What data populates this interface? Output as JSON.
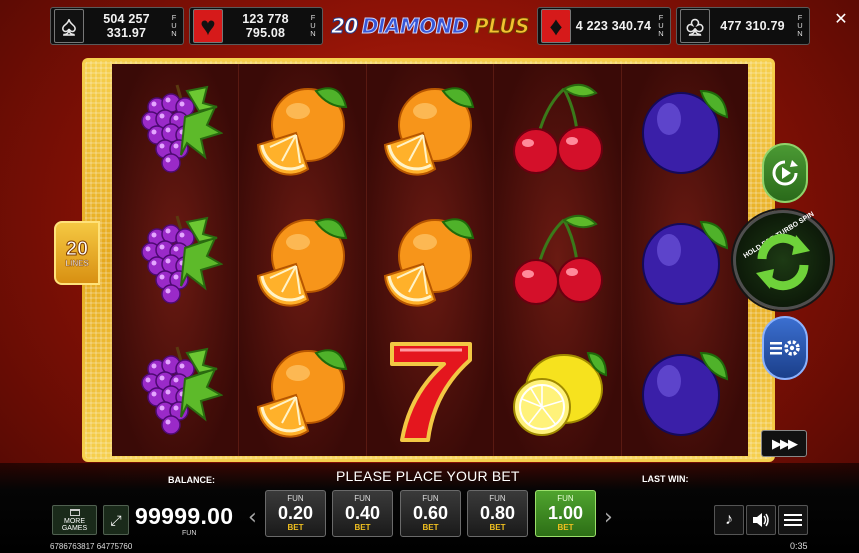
{
  "jackpots": [
    {
      "suit": "spade-icon",
      "glyph": "♠",
      "amount": "504 257 331.97",
      "currency": "FUN"
    },
    {
      "suit": "heart-icon",
      "glyph": "♥",
      "amount": "123 778 795.08",
      "currency": "FUN"
    },
    {
      "suit": "diamond-icon",
      "glyph": "♦",
      "amount": "4 223 340.74",
      "currency": "FUN"
    },
    {
      "suit": "club-icon",
      "glyph": "♣",
      "amount": "477 310.79",
      "currency": "FUN"
    }
  ],
  "logo": {
    "part1": "20",
    "part2": "DIAMOND",
    "part3": "PLUS"
  },
  "lines": {
    "count": "20",
    "label": "LINES"
  },
  "reels": [
    [
      "grapes",
      "grapes",
      "grapes"
    ],
    [
      "orange",
      "orange",
      "orange"
    ],
    [
      "orange",
      "orange",
      "seven"
    ],
    [
      "cherry",
      "cherry",
      "lemon"
    ],
    [
      "plum",
      "plum",
      "plum"
    ]
  ],
  "controls": {
    "turbo_label": "HOLD FOR TURBO SPIN",
    "fast_label": "▶▶▶"
  },
  "bottom": {
    "balance_label": "BALANCE:",
    "balance_value": "99999.00",
    "balance_currency": "FUN",
    "message": "PLEASE PLACE YOUR BET",
    "last_win_label": "LAST WIN:",
    "more_games": "MORE GAMES",
    "ticket_id": "6786763817 64775760",
    "clock": "0:35"
  },
  "bets": [
    {
      "currency": "FUN",
      "value": "0.20",
      "label": "BET",
      "active": false
    },
    {
      "currency": "FUN",
      "value": "0.40",
      "label": "BET",
      "active": false
    },
    {
      "currency": "FUN",
      "value": "0.60",
      "label": "BET",
      "active": false
    },
    {
      "currency": "FUN",
      "value": "0.80",
      "label": "BET",
      "active": false
    },
    {
      "currency": "FUN",
      "value": "1.00",
      "label": "BET",
      "active": true
    }
  ],
  "colors": {
    "accent_green": "#4fa42e",
    "gold": "#f0c020",
    "background_red": "#8e1206"
  }
}
